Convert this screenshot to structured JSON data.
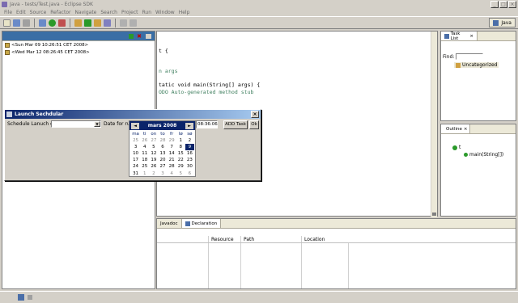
{
  "window": {
    "title": "Java - tests/Test.java - Eclipse SDK"
  },
  "menu": [
    "File",
    "Edit",
    "Source",
    "Refactor",
    "Navigate",
    "Search",
    "Project",
    "Run",
    "Window",
    "Help"
  ],
  "perspective": {
    "label": "Java"
  },
  "log": [
    {
      "text": "<Sun Mar 09 10:26:51 CET 2008>"
    },
    {
      "text": "<Wed Mar 12 08:26:45 CET 2008>"
    }
  ],
  "editor": {
    "lines": [
      "t {",
      "n args",
      "tatic void main(String[] args) {",
      "ODO Auto-generated method stub"
    ]
  },
  "tasklist": {
    "tab": "Task List",
    "find_label": "Find:",
    "category": "Uncategorized"
  },
  "outline": {
    "tab": "Outline",
    "class": "t",
    "method": "main(String[])"
  },
  "bottom": {
    "tabs": [
      "Javadoc",
      "Declaration"
    ],
    "columns": [
      "Resource",
      "Path",
      "Location"
    ]
  },
  "dialog": {
    "title": "Launch Sechdular",
    "schedule_label": "Schedule Lanuch on:",
    "date_label": "Date for run:",
    "time_value": "08:36:06",
    "add_task_label": "ADD Task",
    "ok_label": "Ok",
    "calendar": {
      "prev": "◄",
      "next": "►",
      "month": "mars 2008",
      "weekdays": [
        "ma",
        "ti",
        "on",
        "to",
        "fr",
        "lø",
        "sø"
      ],
      "days": [
        [
          "25",
          "26",
          "27",
          "28",
          "29",
          "1",
          "2"
        ],
        [
          "3",
          "4",
          "5",
          "6",
          "7",
          "8",
          "9"
        ],
        [
          "10",
          "11",
          "12",
          "13",
          "14",
          "15",
          "16"
        ],
        [
          "17",
          "18",
          "19",
          "20",
          "21",
          "22",
          "23"
        ],
        [
          "24",
          "25",
          "26",
          "27",
          "28",
          "29",
          "30"
        ],
        [
          "31",
          "1",
          "2",
          "3",
          "4",
          "5",
          "6"
        ]
      ],
      "selected": "9"
    }
  },
  "colors": {
    "title_active": "#0a246a",
    "view_active": "#3a6ea5"
  }
}
